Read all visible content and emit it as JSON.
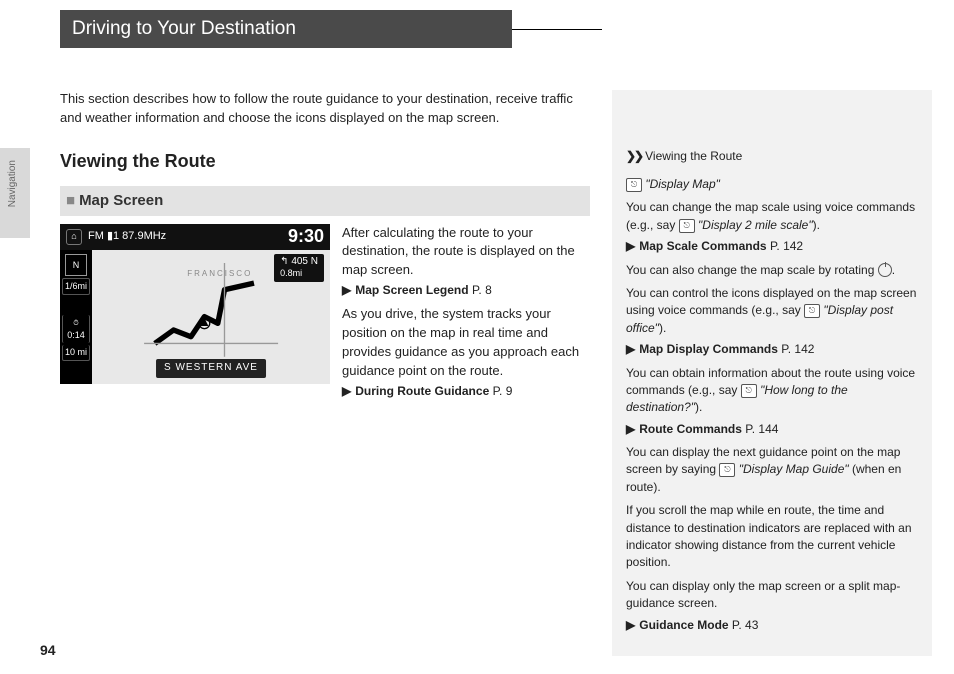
{
  "title": "Driving to Your Destination",
  "sidebar_label": "Navigation",
  "intro": "This section describes how to follow the route guidance to your destination, receive traffic and weather information and choose the icons displayed on the map screen.",
  "section_heading": "Viewing the Route",
  "subheading": "Map Screen",
  "body": {
    "p1": "After calculating the route to your destination, the route is displayed on the map screen.",
    "xref1_label": "Map Screen Legend",
    "xref1_page": "P. 8",
    "p2": "As you drive, the system tracks your position on the map in real time and provides guidance as you approach each guidance point on the route.",
    "xref2_label": "During Route Guidance",
    "xref2_page": "P. 9"
  },
  "screenshot": {
    "home_icon": "⌂",
    "radio": "FM    ▮1  87.9MHz",
    "clock": "9:30",
    "compass": "N",
    "scale": "1/6mi",
    "eta_clock": "0:14",
    "eta_dist": "10 mi",
    "maneuver_road": "405 N",
    "maneuver_dist": "0.8mi",
    "street": "S WESTERN AVE",
    "city": "FRANCISCO"
  },
  "right": {
    "heading": "Viewing the Route",
    "cmd1": "\"Display Map\"",
    "p1a": "You can change the map scale using voice commands (e.g., say ",
    "p1b": "\"Display 2 mile scale\"",
    "p1c": ").",
    "xref1_label": "Map Scale Commands",
    "xref1_page": "P. 142",
    "p2a": "You can also change the map scale by rotating ",
    "p2b": ".",
    "p3a": "You can control the icons displayed on the map screen using voice commands (e.g., say ",
    "p3b": "\"Display post office\"",
    "p3c": ").",
    "xref2_label": "Map Display Commands",
    "xref2_page": "P. 142",
    "p4a": "You can obtain information about the route using voice commands (e.g., say ",
    "p4b": "\"How long to the destination?\"",
    "p4c": ").",
    "xref3_label": "Route Commands",
    "xref3_page": "P. 144",
    "p5a": "You can display the next guidance point on the map screen by saying ",
    "p5b": "\"Display Map Guide\"",
    "p5c": " (when en route).",
    "p6": "If you scroll the map while en route, the time and distance to destination indicators are replaced with an indicator showing distance from the current vehicle position.",
    "p7": "You can display only the map screen or a split map-guidance screen.",
    "xref4_label": "Guidance Mode",
    "xref4_page": "P. 43"
  },
  "page_number": "94"
}
